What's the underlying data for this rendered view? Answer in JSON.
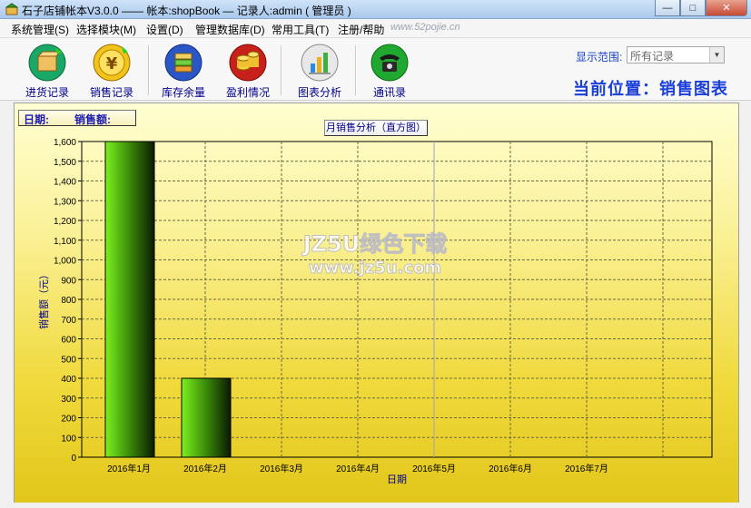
{
  "window": {
    "title": "石子店铺帐本V3.0.0  ——  帐本:shopBook — 记录人:admin ( 管理员 )",
    "minimize": "—",
    "maximize": "□",
    "close": "✕"
  },
  "menu": {
    "items": [
      "系统管理(S)",
      "选择模块(M)",
      "设置(D)",
      "管理数据库(D)",
      "常用工具(T)",
      "注册/帮助"
    ],
    "link": "www.52pojie.cn"
  },
  "toolbar": {
    "buttons": [
      {
        "label": "进货记录",
        "icon": "purchase-box-icon"
      },
      {
        "label": "销售记录",
        "icon": "yuan-coin-icon"
      },
      {
        "label": "库存余量",
        "icon": "stock-books-icon"
      },
      {
        "label": "盈利情况",
        "icon": "profit-coins-icon"
      },
      {
        "label": "图表分析",
        "icon": "bar-chart-icon"
      },
      {
        "label": "通讯录",
        "icon": "telephone-icon"
      }
    ],
    "range_label": "显示范围:",
    "range_value": "所有记录",
    "current_position": "当前位置：销售图表"
  },
  "filter": {
    "date_label": "日期:",
    "sales_label": "销售额:"
  },
  "colors": {
    "bar_light": "#7cf01e",
    "bar_dark": "#0a1a02",
    "axis_text": "#00008b",
    "panel_top": "#ffffd2",
    "panel_bottom": "#e2c61a"
  },
  "chart_data": {
    "type": "bar",
    "title": "月销售分析（直方图）",
    "xlabel": "日期",
    "ylabel": "销售额（元）",
    "categories": [
      "2016年1月",
      "2016年2月",
      "2016年3月",
      "2016年4月",
      "2016年5月",
      "2016年6月",
      "2016年7月"
    ],
    "values": [
      1600,
      400,
      0,
      0,
      0,
      0,
      0
    ],
    "ylim": [
      0,
      1600
    ],
    "yticks": [
      "0",
      "100",
      "200",
      "300",
      "400",
      "500",
      "600",
      "700",
      "800",
      "900",
      "1,000",
      "1,100",
      "1,200",
      "1,300",
      "1,400",
      "1,500",
      "1,600"
    ],
    "grid": true
  },
  "watermark": {
    "line1": "JZ5U绿色下载",
    "line2": "www.jz5u.com"
  }
}
